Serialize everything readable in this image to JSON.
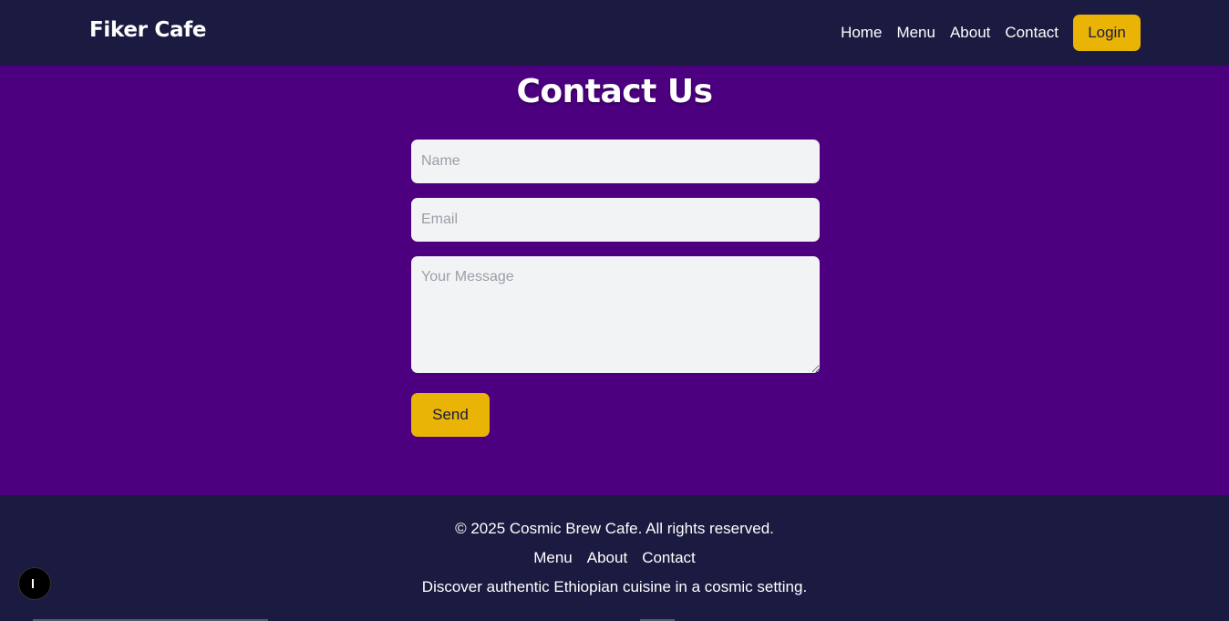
{
  "header": {
    "brand": "Fiker Cafe",
    "nav": [
      "Home",
      "Menu",
      "About",
      "Contact"
    ],
    "login_label": "Login"
  },
  "contact": {
    "title": "Contact Us",
    "name_placeholder": "Name",
    "email_placeholder": "Email",
    "message_placeholder": "Your Message",
    "send_label": "Send"
  },
  "footer": {
    "copyright": "© 2025 Cosmic Brew Cafe. All rights reserved.",
    "links": [
      "Menu",
      "About",
      "Contact"
    ],
    "tagline": "Discover authentic Ethiopian cuisine in a cosmic setting."
  },
  "colors": {
    "navbar_bg": "#1b1a40",
    "main_bg": "#4c0080",
    "accent": "#e9b406",
    "input_bg": "#f2f3f5"
  },
  "icons": {
    "floating_button": "cursor-icon"
  }
}
